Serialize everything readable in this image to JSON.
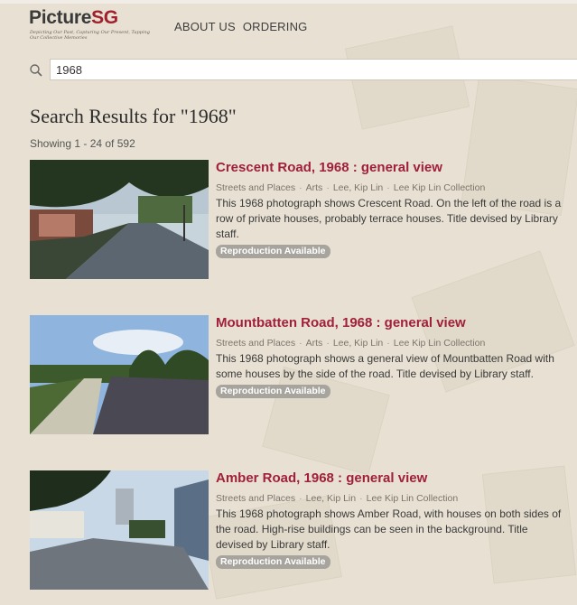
{
  "brand": {
    "title_main": "Picture",
    "title_accent": "SG",
    "tagline": "Depicting Our Past, Capturing Our Present, Tapping Our Collective Memories"
  },
  "nav": {
    "about": "ABOUT US",
    "ordering": "ORDERING"
  },
  "search": {
    "value": "1968"
  },
  "results_heading": "Search Results for \"1968\"",
  "showing": "Showing 1 - 24 of 592",
  "results": [
    {
      "title": "Crescent Road, 1968 : general view",
      "tags": [
        "Streets and Places",
        "Arts",
        "Lee, Kip Lin",
        "Lee Kip Lin Collection"
      ],
      "description": "This 1968 photograph shows Crescent Road. On the left of the road is a row of private houses, probably terrace houses. Title devised by Library staff.",
      "badge": "Reproduction Available"
    },
    {
      "title": "Mountbatten Road, 1968 : general view",
      "tags": [
        "Streets and Places",
        "Arts",
        "Lee, Kip Lin",
        "Lee Kip Lin Collection"
      ],
      "description": "This 1968 photograph shows a general view of Mountbatten Road with some houses by the side of the road. Title devised by Library staff.",
      "badge": "Reproduction Available"
    },
    {
      "title": "Amber Road, 1968 : general view",
      "tags": [
        "Streets and Places",
        "Lee, Kip Lin",
        "Lee Kip Lin Collection"
      ],
      "description": "This 1968 photograph shows Amber Road, with houses on both sides of the road. High-rise buildings can be seen in the background. Title devised by Library staff.",
      "badge": "Reproduction Available"
    }
  ]
}
